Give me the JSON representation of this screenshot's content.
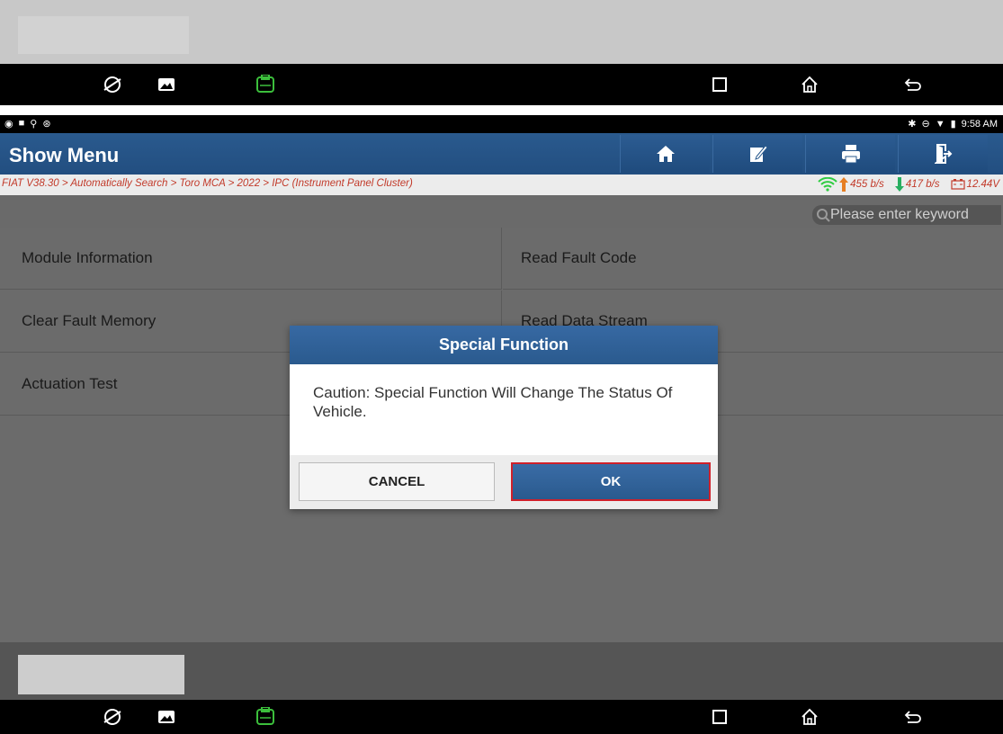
{
  "app": {
    "title": "Show Menu",
    "breadcrumb": "FIAT V38.30 > Automatically Search > Toro MCA > 2022 > IPC (Instrument Panel Cluster)",
    "upload_speed": "455 b/s",
    "download_speed": "417 b/s",
    "voltage": "12.44V",
    "search_placeholder": "Please enter keyword"
  },
  "statusbar": {
    "time": "9:58 AM"
  },
  "menu": {
    "items": [
      {
        "label": "Module Information"
      },
      {
        "label": "Read Fault Code"
      },
      {
        "label": "Clear Fault Memory"
      },
      {
        "label": "Read Data Stream"
      },
      {
        "label": "Actuation Test"
      },
      {
        "label": ""
      }
    ]
  },
  "dialog": {
    "title": "Special Function",
    "message": "Caution: Special Function Will Change The Status Of Vehicle.",
    "cancel_label": "CANCEL",
    "ok_label": "OK"
  },
  "colors": {
    "header": "#2a5a8e",
    "ok_border": "#d0202a",
    "breadcrumb_text": "#c23a2a",
    "wifi": "#2ecc40",
    "up_arrow": "#e67e22",
    "down_arrow": "#27ae60"
  },
  "icons": [
    "browser-icon",
    "gallery-icon",
    "vci-icon",
    "recent-apps-icon",
    "home-nav-icon",
    "back-nav-icon",
    "home-icon",
    "edit-icon",
    "print-icon",
    "exit-icon",
    "search-icon",
    "wifi-icon",
    "upload-arrow-icon",
    "download-arrow-icon",
    "battery-icon"
  ]
}
